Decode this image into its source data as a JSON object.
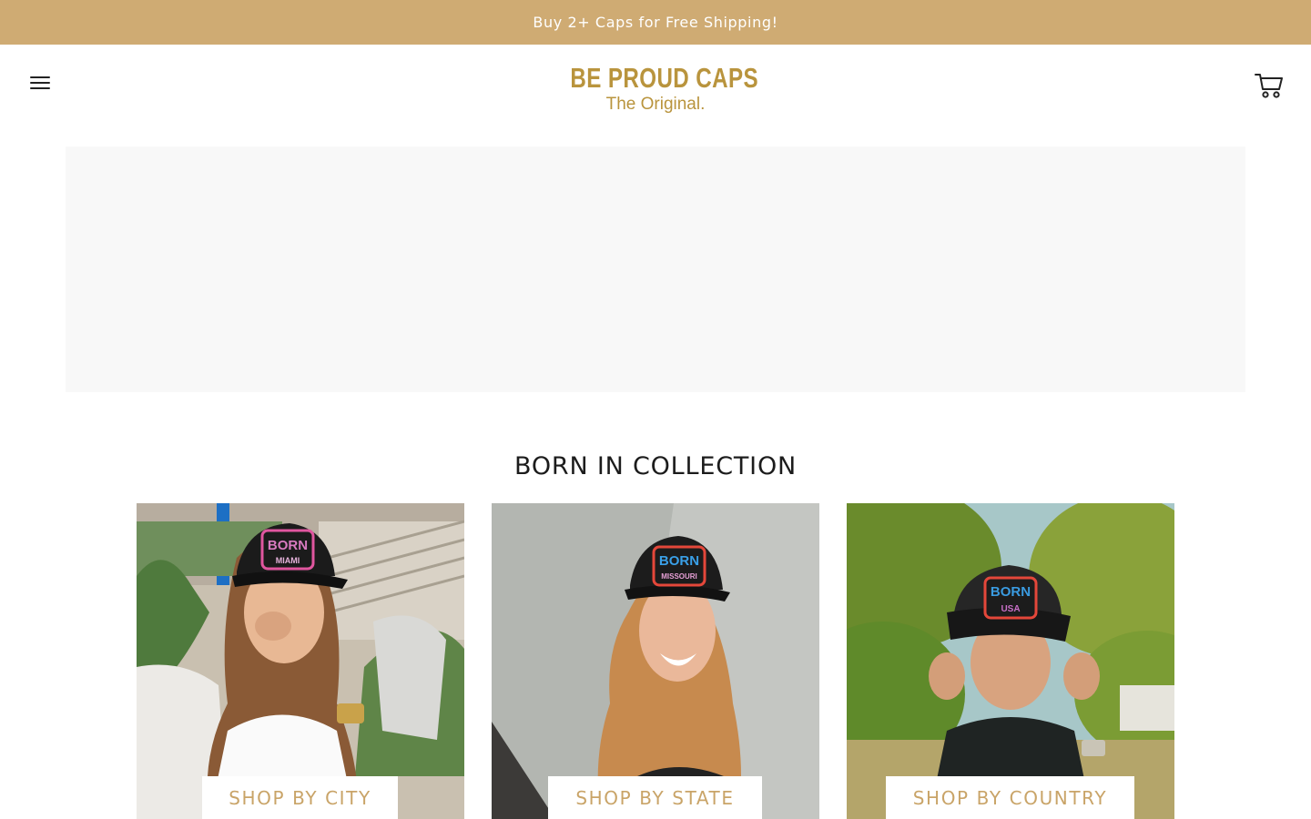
{
  "announcement": {
    "text": "Buy 2+ Caps for Free Shipping!"
  },
  "header": {
    "menu_icon": "hamburger-menu-icon",
    "logo": {
      "title": "BE PROUD CAPS",
      "tagline": "The Original."
    },
    "cart_icon": "shopping-cart-icon"
  },
  "collection": {
    "title": "BORN IN COLLECTION",
    "cards": [
      {
        "label": "SHOP BY CITY",
        "patch_top": "BORN",
        "patch_bottom": "MIAMI"
      },
      {
        "label": "SHOP BY STATE",
        "patch_top": "BORN",
        "patch_bottom": "MISSOURI"
      },
      {
        "label": "SHOP BY COUNTRY",
        "patch_top": "BORN",
        "patch_bottom": "USA"
      }
    ]
  },
  "colors": {
    "accent": "#cfab73",
    "logo": "#b9943d",
    "button_text": "#c9a468",
    "hero_placeholder": "#f8f8f8"
  }
}
